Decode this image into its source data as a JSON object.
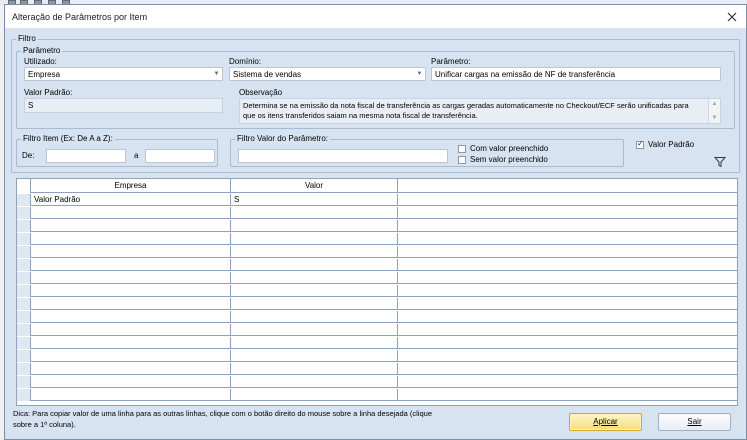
{
  "dialog": {
    "title": "Alteração de Parâmetros por Item"
  },
  "filtro": {
    "label": "Filtro",
    "parametro_group": {
      "label": "Parâmetro",
      "utilizado": {
        "label": "Utilizado:",
        "value": "Empresa"
      },
      "dominio": {
        "label": "Domínio:",
        "value": "Sistema de vendas"
      },
      "parametro": {
        "label": "Parâmetro:",
        "value": "Unificar cargas na emissão de NF de transferência"
      },
      "valor_padrao": {
        "label": "Valor Padrão:",
        "value": "S"
      },
      "observacao": {
        "label": "Observação",
        "value": "Determina se na emissão da nota fiscal de transferência as cargas geradas automaticamente no Checkout/ECF serão unificadas para que os itens transferidos saiam na mesma nota fiscal de transferência."
      }
    },
    "filtro_item": {
      "label": "Filtro Item (Ex: De A a Z):",
      "de_label": "De:",
      "de_value": "",
      "a_label": "a",
      "a_value": ""
    },
    "filtro_valor": {
      "label": "Filtro Valor do Parâmetro:",
      "value": "",
      "com_valor": "Com valor preenchido",
      "sem_valor": "Sem valor preenchido"
    },
    "valor_padrao_check": {
      "label": "Valor Padrão",
      "checked": true
    }
  },
  "grid": {
    "columns": [
      "Empresa",
      "Valor"
    ],
    "rows": [
      {
        "empresa": "Valor Padrão",
        "valor": "S"
      }
    ]
  },
  "footer": {
    "tip": "Dica: Para copiar valor de uma linha para as outras linhas, clique com o botão direito do mouse sobre a linha desejada (clique sobre a 1ª coluna).",
    "aplicar": "Aplicar",
    "sair": "Sair"
  },
  "icons": {
    "close": "close-icon",
    "filter": "filter-icon",
    "dropdown": "chevron-down-icon"
  },
  "colors": {
    "accent": "#f5dc7a",
    "panel": "#d7e3f1"
  }
}
